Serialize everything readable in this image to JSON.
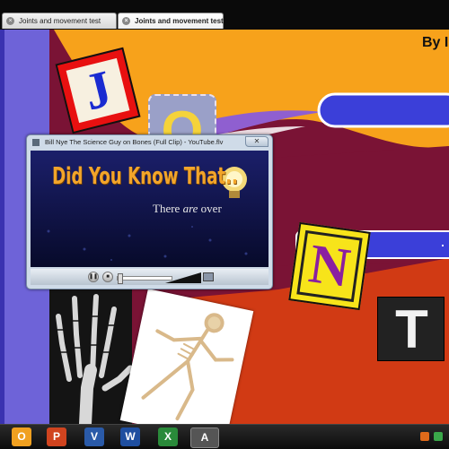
{
  "tabs": [
    {
      "label": "Joints and movement test",
      "active": false
    },
    {
      "label": "Joints and movement test",
      "active": true
    }
  ],
  "slide": {
    "byline": "By I",
    "title_letters": [
      "J",
      "O",
      "N",
      "T"
    ],
    "colors": {
      "background": "#7a1335",
      "orange": "#f7a21b",
      "blue": "#3b3fd9",
      "lavender": "#6e63d8",
      "red": "#d13a14"
    }
  },
  "player": {
    "title": "Bill Nye The Science Guy on Bones (Full Clip) - YouTube.flv",
    "video_heading": "Did You Know That..",
    "video_caption_1": "There",
    "video_caption_2": "are",
    "video_caption_3": "over",
    "progress": 0.02,
    "volume": 0.8
  },
  "taskbar": {
    "apps": [
      "outlook-icon",
      "powerpoint-icon",
      "visio-icon",
      "word-icon",
      "excel-icon",
      "app-icon"
    ]
  }
}
